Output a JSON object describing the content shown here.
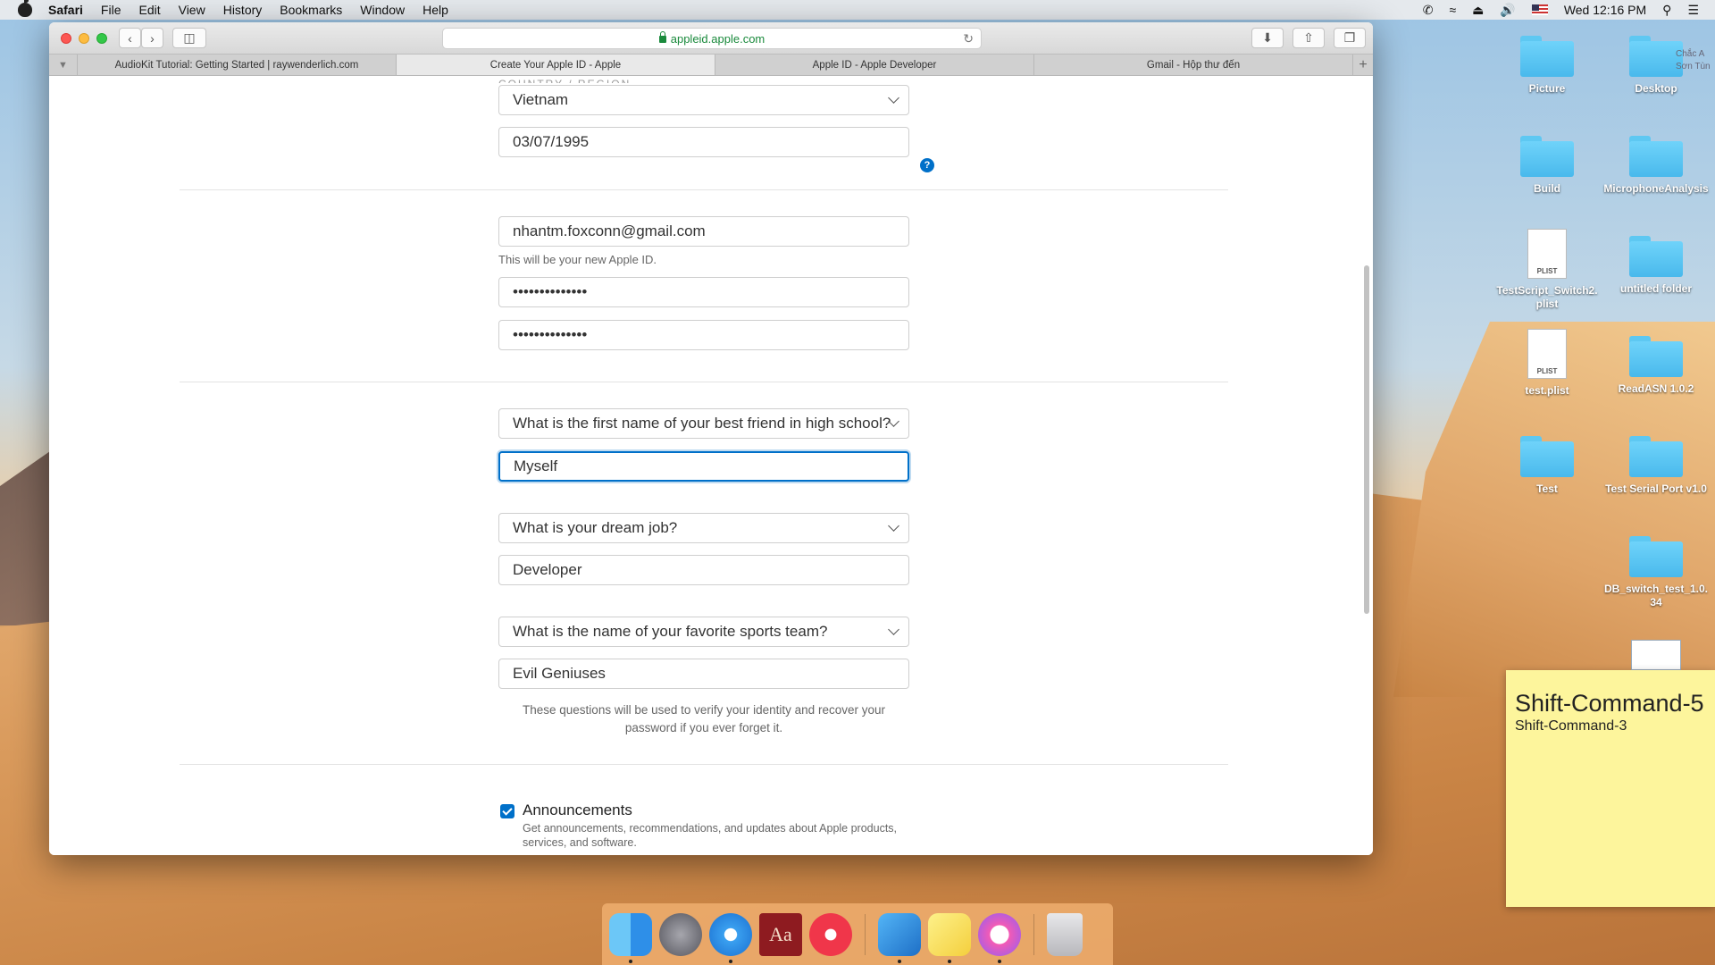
{
  "menubar": {
    "app": "Safari",
    "items": [
      "File",
      "Edit",
      "View",
      "History",
      "Bookmarks",
      "Window",
      "Help"
    ],
    "clock": "Wed 12:16 PM"
  },
  "browser": {
    "address": "appleid.apple.com",
    "tabs": [
      {
        "title": "AudioKit Tutorial: Getting Started | raywenderlich.com",
        "active": false
      },
      {
        "title": "Create Your Apple ID - Apple",
        "active": true
      },
      {
        "title": "Apple ID - Apple Developer",
        "active": false
      },
      {
        "title": "Gmail - Hộp thư đến",
        "active": false
      }
    ]
  },
  "form": {
    "country_label_cut": "COUNTRY / REGION",
    "country": "Vietnam",
    "birthday": "03/07/1995",
    "help_icon": "?",
    "email": "nhantm.foxconn@gmail.com",
    "email_helper": "This will be your new Apple ID.",
    "password": "••••••••••••••",
    "confirm_password": "••••••••••••••",
    "q1": "What is the first name of your best friend in high school?",
    "a1": "Myself",
    "q2": "What is your dream job?",
    "a2": "Developer",
    "q3": "What is the name of your favorite sports team?",
    "a3": "Evil Geniuses",
    "questions_note": "These questions will be used to verify your identity and recover your password if you ever forget it.",
    "announcements_title": "Announcements",
    "announcements_desc": "Get announcements, recommendations, and updates about Apple products, services, and software.",
    "announcements_checked": true
  },
  "desktop": {
    "icons": [
      {
        "label": "Picture",
        "kind": "folder"
      },
      {
        "label": "Desktop",
        "kind": "folder"
      },
      {
        "label": "Build",
        "kind": "folder"
      },
      {
        "label": "MicrophoneAnalysis",
        "kind": "folder"
      },
      {
        "label": "TestScript_Switch2.plist",
        "kind": "plist"
      },
      {
        "label": "untitled folder",
        "kind": "folder"
      },
      {
        "label": "test.plist",
        "kind": "plist"
      },
      {
        "label": "ReadASN 1.0.2",
        "kind": "folder"
      },
      {
        "label": "Test",
        "kind": "folder"
      },
      {
        "label": "Test Serial Port v1.0",
        "kind": "folder"
      },
      {
        "label": "DB_switch_test_1.0.34",
        "kind": "folder"
      }
    ],
    "plist_badge": "PLIST",
    "notification_partial": "Chắc A",
    "notification_partial2": "Sơn Tùn"
  },
  "sticky": {
    "title": "Shift-Command-5",
    "subtitle": "Shift-Command-3"
  },
  "dock": {
    "apps": [
      "finder-icon",
      "launchpad-icon",
      "safari-icon",
      "dictionary-icon",
      "news-icon",
      "xcode-icon",
      "stickies-icon",
      "itunes-icon",
      "trash-icon"
    ],
    "dictionary_glyph": "Aa"
  },
  "colors": {
    "accent": "#0070c9",
    "secure": "#1a8a3c"
  }
}
